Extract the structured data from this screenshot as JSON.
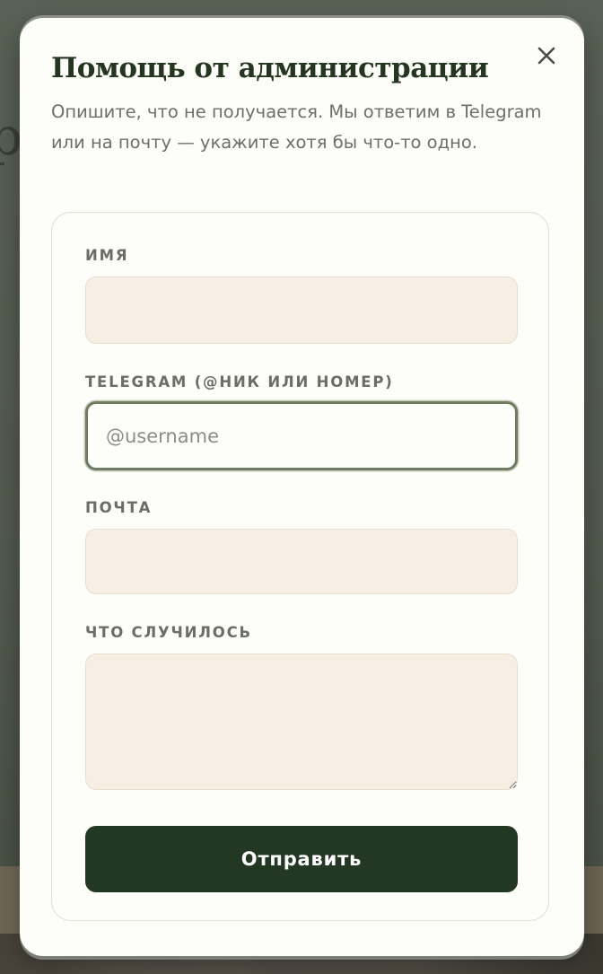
{
  "background": {
    "partial_heading": "ра"
  },
  "modal": {
    "title": "Помощь от администрации",
    "subtitle": "Опишите, что не получается. Мы ответим в Telegram или на почту — укажите хотя бы что-то одно.",
    "close_icon": "close-icon"
  },
  "form": {
    "name": {
      "label": "ИМЯ",
      "value": "",
      "placeholder": ""
    },
    "telegram": {
      "label": "TELEGRAM (@НИК ИЛИ НОМЕР)",
      "value": "",
      "placeholder": "@username"
    },
    "email": {
      "label": "ПОЧТА",
      "value": "",
      "placeholder": ""
    },
    "message": {
      "label": "ЧТО СЛУЧИЛОСЬ",
      "value": "",
      "placeholder": ""
    },
    "submit_label": "Отправить"
  },
  "colors": {
    "accent": "#233823",
    "field_bg": "#f7efe4",
    "focus_border": "#6f7c62",
    "modal_bg": "#fdfdf9"
  }
}
